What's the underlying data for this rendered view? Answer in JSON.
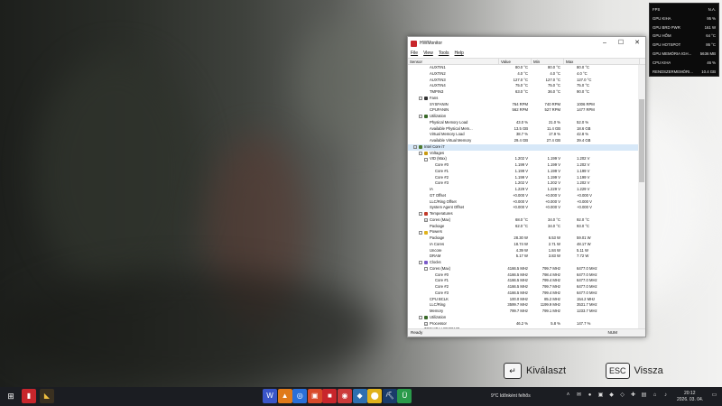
{
  "overlay": {
    "rows": [
      {
        "label": "FPS",
        "value": "N.A."
      },
      {
        "label": "GPU KIHA",
        "value": "95 %"
      },
      {
        "label": "GPU BRD PWR",
        "value": "161 W"
      },
      {
        "label": "GPU HŐM",
        "value": "64 °C"
      },
      {
        "label": "GPU HOTSPOT",
        "value": "86 °C"
      },
      {
        "label": "GPU MEMÓRIA IGH...",
        "value": "5636 MB"
      },
      {
        "label": "CPU KIHA",
        "value": "46 %"
      },
      {
        "label": "RENDSZERMEMÓRI...",
        "value": "10.4 GB"
      }
    ]
  },
  "window": {
    "title": "HWMonitor",
    "menu": [
      "File",
      "View",
      "Tools",
      "Help"
    ],
    "columns": [
      "Sensor",
      "Value",
      "Min",
      "Max"
    ],
    "status_left": "Ready",
    "status_right": "NUM"
  },
  "rows": [
    {
      "d": 4,
      "name": "AUXTIN1",
      "v": "80.0 °C",
      "min": "80.0 °C",
      "max": "80.0 °C"
    },
    {
      "d": 4,
      "name": "AUXTIN2",
      "v": "4.0 °C",
      "min": "4.0 °C",
      "max": "4.0 °C"
    },
    {
      "d": 4,
      "name": "AUXTIN3",
      "v": "127.0 °C",
      "min": "127.0 °C",
      "max": "127.0 °C"
    },
    {
      "d": 4,
      "name": "AUXTIN4",
      "v": "75.0 °C",
      "min": "75.0 °C",
      "max": "75.0 °C"
    },
    {
      "d": 4,
      "name": "TMPIN3",
      "v": "63.0 °C",
      "min": "36.0 °C",
      "max": "90.0 °C"
    },
    {
      "d": 2,
      "name": "Fans",
      "tree": "-",
      "icon": "fan-icon",
      "color": "#333333"
    },
    {
      "d": 4,
      "name": "SYSFANIN",
      "v": "764 RPM",
      "min": "740 RPM",
      "max": "1006 RPM"
    },
    {
      "d": 4,
      "name": "CPUFANIN",
      "v": "562 RPM",
      "min": "527 RPM",
      "max": "1477 RPM"
    },
    {
      "d": 2,
      "name": "Utilization",
      "tree": "-",
      "icon": "utilization-icon",
      "color": "#3a6a2a"
    },
    {
      "d": 4,
      "name": "Physical Memory Load",
      "v": "43.0 %",
      "min": "21.0 %",
      "max": "52.0 %"
    },
    {
      "d": 4,
      "name": "Available Physical Mem...",
      "v": "13.5 GB",
      "min": "11.4 GB",
      "max": "18.6 GB"
    },
    {
      "d": 4,
      "name": "Virtual Memory Load",
      "v": "38.7 %",
      "min": "17.9 %",
      "max": "42.8 %"
    },
    {
      "d": 4,
      "name": "Available Virtual Memory",
      "v": "29.4 GB",
      "min": "27.4 GB",
      "max": "39.4 GB"
    },
    {
      "d": 1,
      "name": "Intel Core i7",
      "tree": "-",
      "icon": "cpu-icon",
      "color": "#4d7a2f",
      "sel": true
    },
    {
      "d": 2,
      "name": "Voltages",
      "tree": "-",
      "icon": "voltage-icon",
      "color": "#c99a12"
    },
    {
      "d": 3,
      "name": "VID (Max)",
      "tree": "-",
      "v": "1.202 V",
      "min": "1.199 V",
      "max": "1.202 V"
    },
    {
      "d": 5,
      "name": "Core #0",
      "v": "1.199 V",
      "min": "1.199 V",
      "max": "1.202 V"
    },
    {
      "d": 5,
      "name": "Core #1",
      "v": "1.199 V",
      "min": "1.199 V",
      "max": "1.199 V"
    },
    {
      "d": 5,
      "name": "Core #2",
      "v": "1.199 V",
      "min": "1.199 V",
      "max": "1.199 V"
    },
    {
      "d": 5,
      "name": "Core #3",
      "v": "1.202 V",
      "min": "1.202 V",
      "max": "1.202 V"
    },
    {
      "d": 4,
      "name": "IA",
      "v": "1.229 V",
      "min": "1.229 V",
      "max": "1.229 V"
    },
    {
      "d": 4,
      "name": "GT Offset",
      "v": "+0.000 V",
      "min": "+0.000 V",
      "max": "+0.000 V"
    },
    {
      "d": 4,
      "name": "LLC/Ring Offset",
      "v": "+0.000 V",
      "min": "+0.000 V",
      "max": "+0.000 V"
    },
    {
      "d": 4,
      "name": "System Agent Offset",
      "v": "+0.000 V",
      "min": "+0.000 V",
      "max": "+0.000 V"
    },
    {
      "d": 2,
      "name": "Temperatures",
      "tree": "-",
      "icon": "thermometer-icon",
      "color": "#c23a2a"
    },
    {
      "d": 3,
      "name": "Cores (Max)",
      "tree": "+",
      "v": "68.0 °C",
      "min": "34.0 °C",
      "max": "92.0 °C"
    },
    {
      "d": 4,
      "name": "Package",
      "v": "62.0 °C",
      "min": "34.0 °C",
      "max": "93.0 °C"
    },
    {
      "d": 2,
      "name": "Powers",
      "tree": "-",
      "icon": "power-icon",
      "color": "#e0b21c"
    },
    {
      "d": 4,
      "name": "Package",
      "v": "28.30 W",
      "min": "6.53 W",
      "max": "59.01 W"
    },
    {
      "d": 4,
      "name": "IA Cores",
      "v": "18.74 W",
      "min": "2.71 W",
      "max": "48.17 W"
    },
    {
      "d": 4,
      "name": "Uncore",
      "v": "4.39 W",
      "min": "1.84 W",
      "max": "5.11 W"
    },
    {
      "d": 4,
      "name": "DRAM",
      "v": "5.17 W",
      "min": "3.83 W",
      "max": "7.72 W"
    },
    {
      "d": 2,
      "name": "Clocks",
      "tree": "-",
      "icon": "clock-icon",
      "color": "#7a5ac9"
    },
    {
      "d": 3,
      "name": "Cores (Max)",
      "tree": "-",
      "v": "4166.5 MHz",
      "min": "799.7 MHz",
      "max": "6477.0 MHz"
    },
    {
      "d": 5,
      "name": "Core #0",
      "v": "4166.5 MHz",
      "min": "798.4 MHz",
      "max": "6477.0 MHz"
    },
    {
      "d": 5,
      "name": "Core #1",
      "v": "4166.5 MHz",
      "min": "799.4 MHz",
      "max": "6477.0 MHz"
    },
    {
      "d": 5,
      "name": "Core #2",
      "v": "4166.5 MHz",
      "min": "799.7 MHz",
      "max": "6477.0 MHz"
    },
    {
      "d": 5,
      "name": "Core #3",
      "v": "4166.5 MHz",
      "min": "799.4 MHz",
      "max": "6477.0 MHz"
    },
    {
      "d": 4,
      "name": "CPU BCLK",
      "v": "100.0 MHz",
      "min": "85.2 MHz",
      "max": "154.2 MHz"
    },
    {
      "d": 4,
      "name": "LLC/Ring",
      "v": "3599.7 MHz",
      "min": "1199.9 MHz",
      "max": "3531.7 MHz"
    },
    {
      "d": 4,
      "name": "Memory",
      "v": "799.7 MHz",
      "min": "799.1 MHz",
      "max": "1233.7 MHz"
    },
    {
      "d": 2,
      "name": "Utilization",
      "tree": "-",
      "icon": "utilization-icon",
      "color": "#3a6a2a"
    },
    {
      "d": 3,
      "name": "Processor",
      "tree": "+",
      "v": "46.2 %",
      "min": "5.8 %",
      "max": "147.7 %"
    },
    {
      "d": 1,
      "name": "TOSHIBA HDWR120",
      "tree": "-",
      "icon": "disk-icon",
      "color": "#556677"
    }
  ],
  "hints": {
    "select_key": "↵",
    "select_label": "Kiválaszt",
    "back_key": "ESC",
    "back_label": "Vissza"
  },
  "taskbar": {
    "apps": [
      "W",
      "▲",
      "◎",
      "▣",
      "■",
      "◉",
      "◆",
      "⬤",
      "⛏",
      "Ü"
    ],
    "weather": "9°C  Időnként felhős",
    "time": "20:12",
    "date": "2026. 03. 04."
  }
}
